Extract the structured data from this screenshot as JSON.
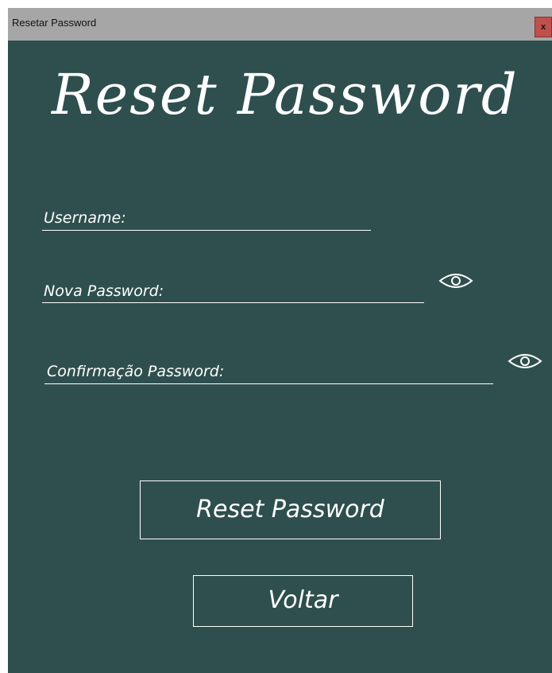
{
  "window": {
    "title": "Resetar Password",
    "close_label": "x"
  },
  "heading": "Reset Password",
  "form": {
    "username_label": "Username:",
    "new_password_label": "Nova Password:",
    "confirm_password_label": "Confirmação Password:",
    "username_value": "",
    "new_password_value": "",
    "confirm_password_value": ""
  },
  "buttons": {
    "reset_label": "Reset Password",
    "back_label": "Voltar"
  },
  "icons": {
    "toggle_new_password": "eye-icon",
    "toggle_confirm_password": "eye-icon"
  },
  "colors": {
    "background": "#2f4f4f",
    "titlebar": "#a6a6a6",
    "close_button": "#c0504d",
    "foreground": "#ffffff"
  }
}
